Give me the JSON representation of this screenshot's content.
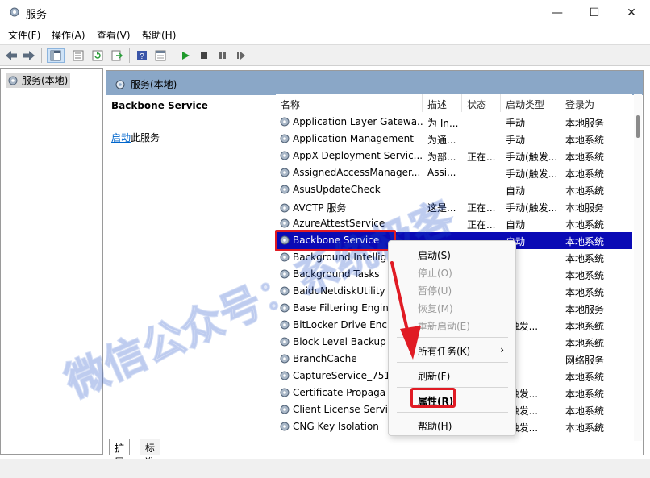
{
  "window": {
    "title": "服务",
    "minimize_glyph": "—",
    "maximize_glyph": "☐",
    "close_glyph": "✕"
  },
  "menubar": [
    "文件(F)",
    "操作(A)",
    "查看(V)",
    "帮助(H)"
  ],
  "tree": {
    "root_label": "服务(本地)"
  },
  "main": {
    "header_title": "服务(本地)",
    "selected_service_title": "Backbone Service",
    "start_link": "启动",
    "start_link_suffix": "此服务"
  },
  "list": {
    "columns": [
      "名称",
      "描述",
      "状态",
      "启动类型",
      "登录为"
    ],
    "rows": [
      {
        "name": "Application Layer Gatewa...",
        "desc": "为 In...",
        "status": "",
        "start": "手动",
        "logon": "本地服务"
      },
      {
        "name": "Application Management",
        "desc": "为通...",
        "status": "",
        "start": "手动",
        "logon": "本地系统"
      },
      {
        "name": "AppX Deployment Servic...",
        "desc": "为部...",
        "status": "正在...",
        "start": "手动(触发...",
        "logon": "本地系统"
      },
      {
        "name": "AssignedAccessManager...",
        "desc": "Assi...",
        "status": "",
        "start": "手动(触发...",
        "logon": "本地系统"
      },
      {
        "name": "AsusUpdateCheck",
        "desc": "",
        "status": "",
        "start": "自动",
        "logon": "本地系统"
      },
      {
        "name": "AVCTP 服务",
        "desc": "这是...",
        "status": "正在...",
        "start": "手动(触发...",
        "logon": "本地服务"
      },
      {
        "name": "AzureAttestService",
        "desc": "",
        "status": "正在...",
        "start": "自动",
        "logon": "本地系统"
      },
      {
        "name": "Backbone Service",
        "desc": "",
        "status": "",
        "start": "自动",
        "logon": "本地系统",
        "selected": true
      },
      {
        "name": "Background Intellig",
        "desc": "",
        "status": "",
        "start": "",
        "logon": "本地系统"
      },
      {
        "name": "Background Tasks",
        "desc": "",
        "status": "",
        "start": "",
        "logon": "本地系统"
      },
      {
        "name": "BaiduNetdiskUtility",
        "desc": "",
        "status": "",
        "start": "",
        "logon": "本地系统"
      },
      {
        "name": "Base Filtering Engin",
        "desc": "",
        "status": "",
        "start": "",
        "logon": "本地服务"
      },
      {
        "name": "BitLocker Drive Enc",
        "desc": "",
        "status": "",
        "start": "(触发...",
        "logon": "本地系统"
      },
      {
        "name": "Block Level Backup",
        "desc": "",
        "status": "",
        "start": "",
        "logon": "本地系统"
      },
      {
        "name": "BranchCache",
        "desc": "",
        "status": "",
        "start": "",
        "logon": "网络服务"
      },
      {
        "name": "CaptureService_751",
        "desc": "",
        "status": "",
        "start": "",
        "logon": "本地系统"
      },
      {
        "name": "Certificate Propaga",
        "desc": "",
        "status": "",
        "start": "(触发...",
        "logon": "本地系统"
      },
      {
        "name": "Client License Servic",
        "desc": "",
        "status": "",
        "start": "(触发...",
        "logon": "本地系统"
      },
      {
        "name": "CNG Key Isolation",
        "desc": "",
        "status": "",
        "start": "(触发...",
        "logon": "本地系统"
      }
    ]
  },
  "context_menu": {
    "items": [
      {
        "label": "启动(S)",
        "disabled": false
      },
      {
        "label": "停止(O)",
        "disabled": true
      },
      {
        "label": "暂停(U)",
        "disabled": true
      },
      {
        "label": "恢复(M)",
        "disabled": true
      },
      {
        "label": "重新启动(E)",
        "disabled": true
      },
      {
        "label": "所有任务(K)",
        "disabled": false
      },
      {
        "label": "刷新(F)",
        "disabled": false
      },
      {
        "label": "属性(R)",
        "disabled": false
      },
      {
        "label": "帮助(H)",
        "disabled": false
      }
    ],
    "submenu_arrow": "›"
  },
  "tabs": [
    "扩展",
    "标准"
  ],
  "watermark": "微信公众号：系统极客",
  "colors": {
    "selection": "#0a0ab5",
    "highlight_red": "#e01b24",
    "header_blue": "#8aa7c7",
    "link": "#0066cc"
  }
}
